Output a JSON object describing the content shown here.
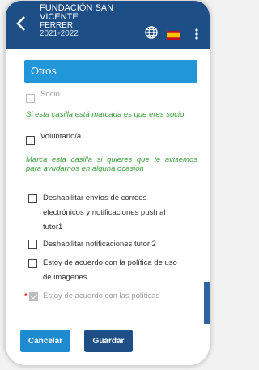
{
  "appbar": {
    "title_line1": "FUNDACIÓN SAN VICENTE",
    "title_line2": "FERRER",
    "title_line3": "2021-2022",
    "back_icon": "arrow-back-icon",
    "globe_icon": "globe-icon",
    "flag_icon": "spanish-flag-icon",
    "menu_icon": "kebab-menu-icon",
    "colors": {
      "background": "#1d4f86",
      "text": "#ffffff"
    }
  },
  "form": {
    "section_title": "Otros",
    "socio_label": "Socio",
    "socio_hint": "Si esta casilla está marcada es que eres socio",
    "voluntario_label": "Voluntario/a",
    "voluntario_hint": "Marca esta casilla si quieres que te avisemos para ayudarnos en alguna ocasión",
    "disable_tutor1_line1": "Deshabilitar envíos de correos",
    "disable_tutor1_line2": "electrónicos y notificaciones push al",
    "disable_tutor1_line3": "tutor1",
    "disable_tutor2_label": "Deshabilitar notificaciones tutor 2",
    "images_line1": "Estoy de acuerdo con la política de uso",
    "images_line2": "de imágenes",
    "required_marker": "•",
    "policies_label": "Estoy de acuerdo con las políticas",
    "colors": {
      "header": "#2196d9",
      "hint": "#3a9e3a",
      "required": "#e53935"
    }
  },
  "buttons": {
    "cancel_label": "Cancelar",
    "save_label": "Guardar",
    "colors": {
      "cancel": "#1e8bd0",
      "save": "#1d4f86"
    }
  }
}
